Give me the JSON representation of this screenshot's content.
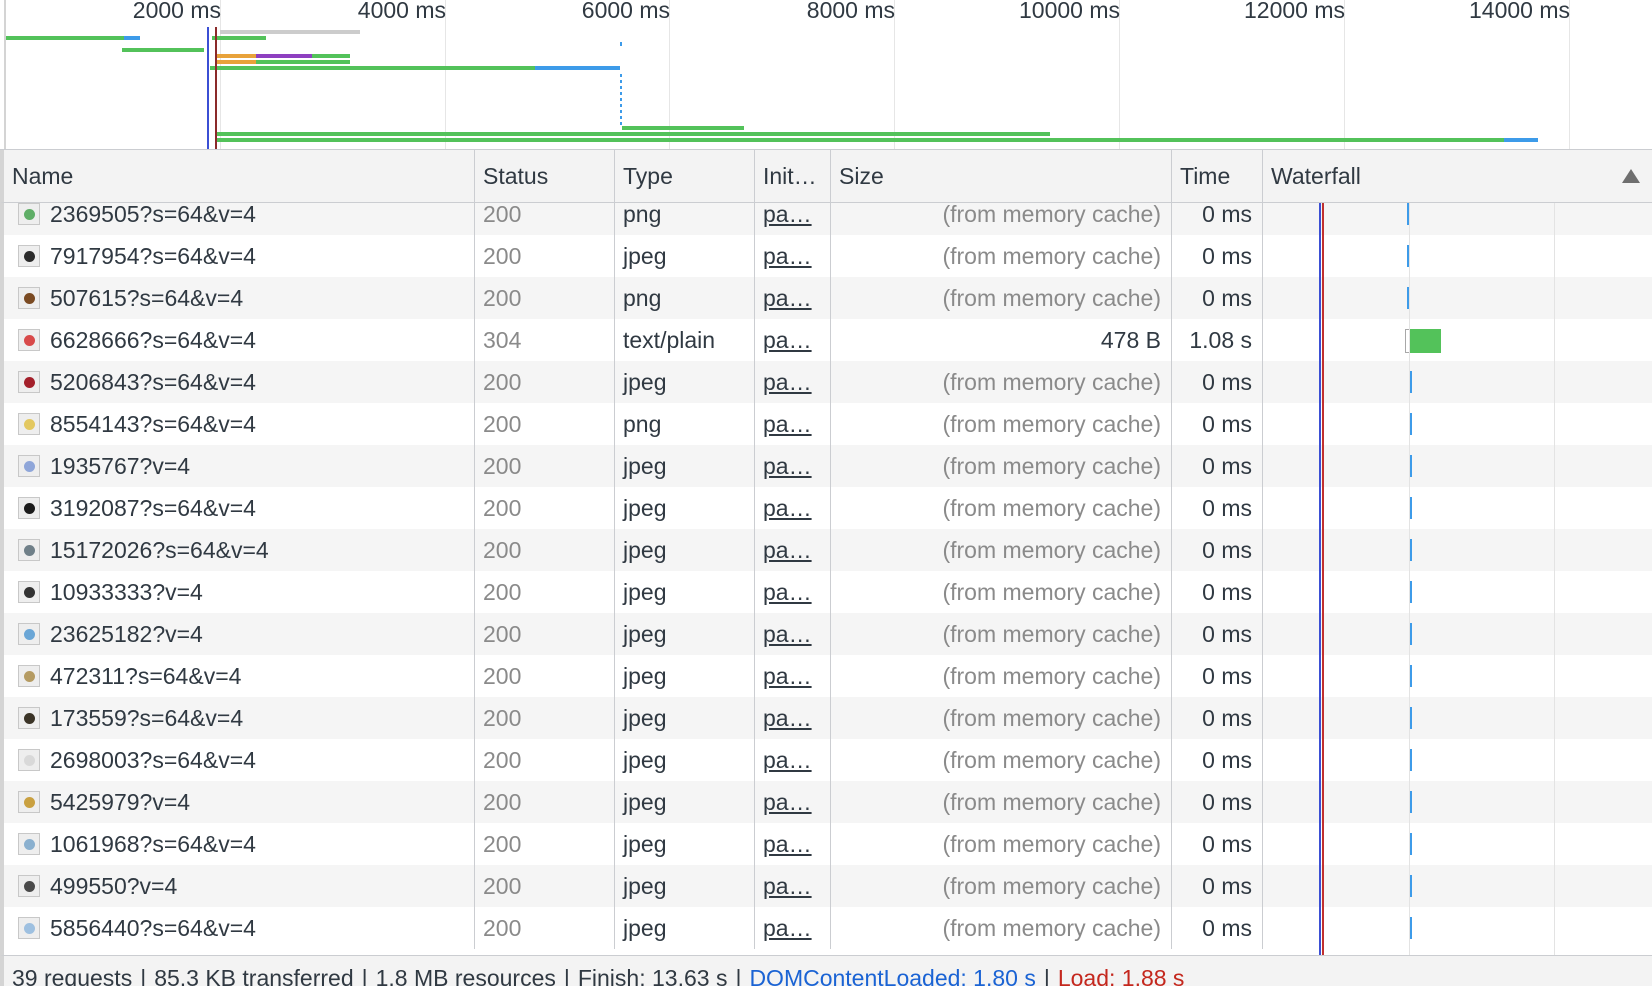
{
  "overview": {
    "ticks": [
      "2000 ms",
      "4000 ms",
      "6000 ms",
      "8000 ms",
      "10000 ms",
      "12000 ms",
      "14000 ms"
    ]
  },
  "columns": {
    "name": "Name",
    "status": "Status",
    "type": "Type",
    "initiator": "Init…",
    "size": "Size",
    "time": "Time",
    "waterfall": "Waterfall"
  },
  "rows": [
    {
      "name": "2369505?s=64&v=4",
      "status": "200",
      "type": "png",
      "initiator": "pa…",
      "size": "(from memory cache)",
      "time": "0 ms",
      "thumb_color": "#5fae67"
    },
    {
      "name": "7917954?s=64&v=4",
      "status": "200",
      "type": "jpeg",
      "initiator": "pa…",
      "size": "(from memory cache)",
      "time": "0 ms",
      "thumb_color": "#2b2b2b"
    },
    {
      "name": "507615?s=64&v=4",
      "status": "200",
      "type": "png",
      "initiator": "pa…",
      "size": "(from memory cache)",
      "time": "0 ms",
      "thumb_color": "#7a4a22"
    },
    {
      "name": "6628666?s=64&v=4",
      "status": "304",
      "type": "text/plain",
      "initiator": "pa…",
      "size": "478 B",
      "time": "1.08 s",
      "thumb_color": "#d84a4a"
    },
    {
      "name": "5206843?s=64&v=4",
      "status": "200",
      "type": "jpeg",
      "initiator": "pa…",
      "size": "(from memory cache)",
      "time": "0 ms",
      "thumb_color": "#a31f2a"
    },
    {
      "name": "8554143?s=64&v=4",
      "status": "200",
      "type": "png",
      "initiator": "pa…",
      "size": "(from memory cache)",
      "time": "0 ms",
      "thumb_color": "#e3c860"
    },
    {
      "name": "1935767?v=4",
      "status": "200",
      "type": "jpeg",
      "initiator": "pa…",
      "size": "(from memory cache)",
      "time": "0 ms",
      "thumb_color": "#8fa6d9"
    },
    {
      "name": "3192087?s=64&v=4",
      "status": "200",
      "type": "jpeg",
      "initiator": "pa…",
      "size": "(from memory cache)",
      "time": "0 ms",
      "thumb_color": "#1c1c1c"
    },
    {
      "name": "15172026?s=64&v=4",
      "status": "200",
      "type": "jpeg",
      "initiator": "pa…",
      "size": "(from memory cache)",
      "time": "0 ms",
      "thumb_color": "#6f7f88"
    },
    {
      "name": "10933333?v=4",
      "status": "200",
      "type": "jpeg",
      "initiator": "pa…",
      "size": "(from memory cache)",
      "time": "0 ms",
      "thumb_color": "#333333"
    },
    {
      "name": "23625182?v=4",
      "status": "200",
      "type": "jpeg",
      "initiator": "pa…",
      "size": "(from memory cache)",
      "time": "0 ms",
      "thumb_color": "#6aa6d6"
    },
    {
      "name": "472311?s=64&v=4",
      "status": "200",
      "type": "jpeg",
      "initiator": "pa…",
      "size": "(from memory cache)",
      "time": "0 ms",
      "thumb_color": "#b59b62"
    },
    {
      "name": "173559?s=64&v=4",
      "status": "200",
      "type": "jpeg",
      "initiator": "pa…",
      "size": "(from memory cache)",
      "time": "0 ms",
      "thumb_color": "#3a3326"
    },
    {
      "name": "2698003?s=64&v=4",
      "status": "200",
      "type": "jpeg",
      "initiator": "pa…",
      "size": "(from memory cache)",
      "time": "0 ms",
      "thumb_color": "#d9d9d9"
    },
    {
      "name": "5425979?v=4",
      "status": "200",
      "type": "jpeg",
      "initiator": "pa…",
      "size": "(from memory cache)",
      "time": "0 ms",
      "thumb_color": "#c9a040"
    },
    {
      "name": "1061968?s=64&v=4",
      "status": "200",
      "type": "jpeg",
      "initiator": "pa…",
      "size": "(from memory cache)",
      "time": "0 ms",
      "thumb_color": "#8ab0cf"
    },
    {
      "name": "499550?v=4",
      "status": "200",
      "type": "jpeg",
      "initiator": "pa…",
      "size": "(from memory cache)",
      "time": "0 ms",
      "thumb_color": "#4a4a4a"
    },
    {
      "name": "5856440?s=64&v=4",
      "status": "200",
      "type": "jpeg",
      "initiator": "pa…",
      "size": "(from memory cache)",
      "time": "0 ms",
      "thumb_color": "#9ec0e0"
    }
  ],
  "summary": {
    "requests": "39 requests",
    "transferred": "85.3 KB transferred",
    "resources": "1.8 MB resources",
    "finish": "Finish: 13.63 s",
    "dom_content_loaded": "DOMContentLoaded: 1.80 s",
    "load": "Load: 1.88 s"
  },
  "colors": {
    "waiting_green": "#53c25a",
    "download_blue": "#3d9be9",
    "dcl_line": "#3b4fd4",
    "load_line": "#c03030"
  }
}
